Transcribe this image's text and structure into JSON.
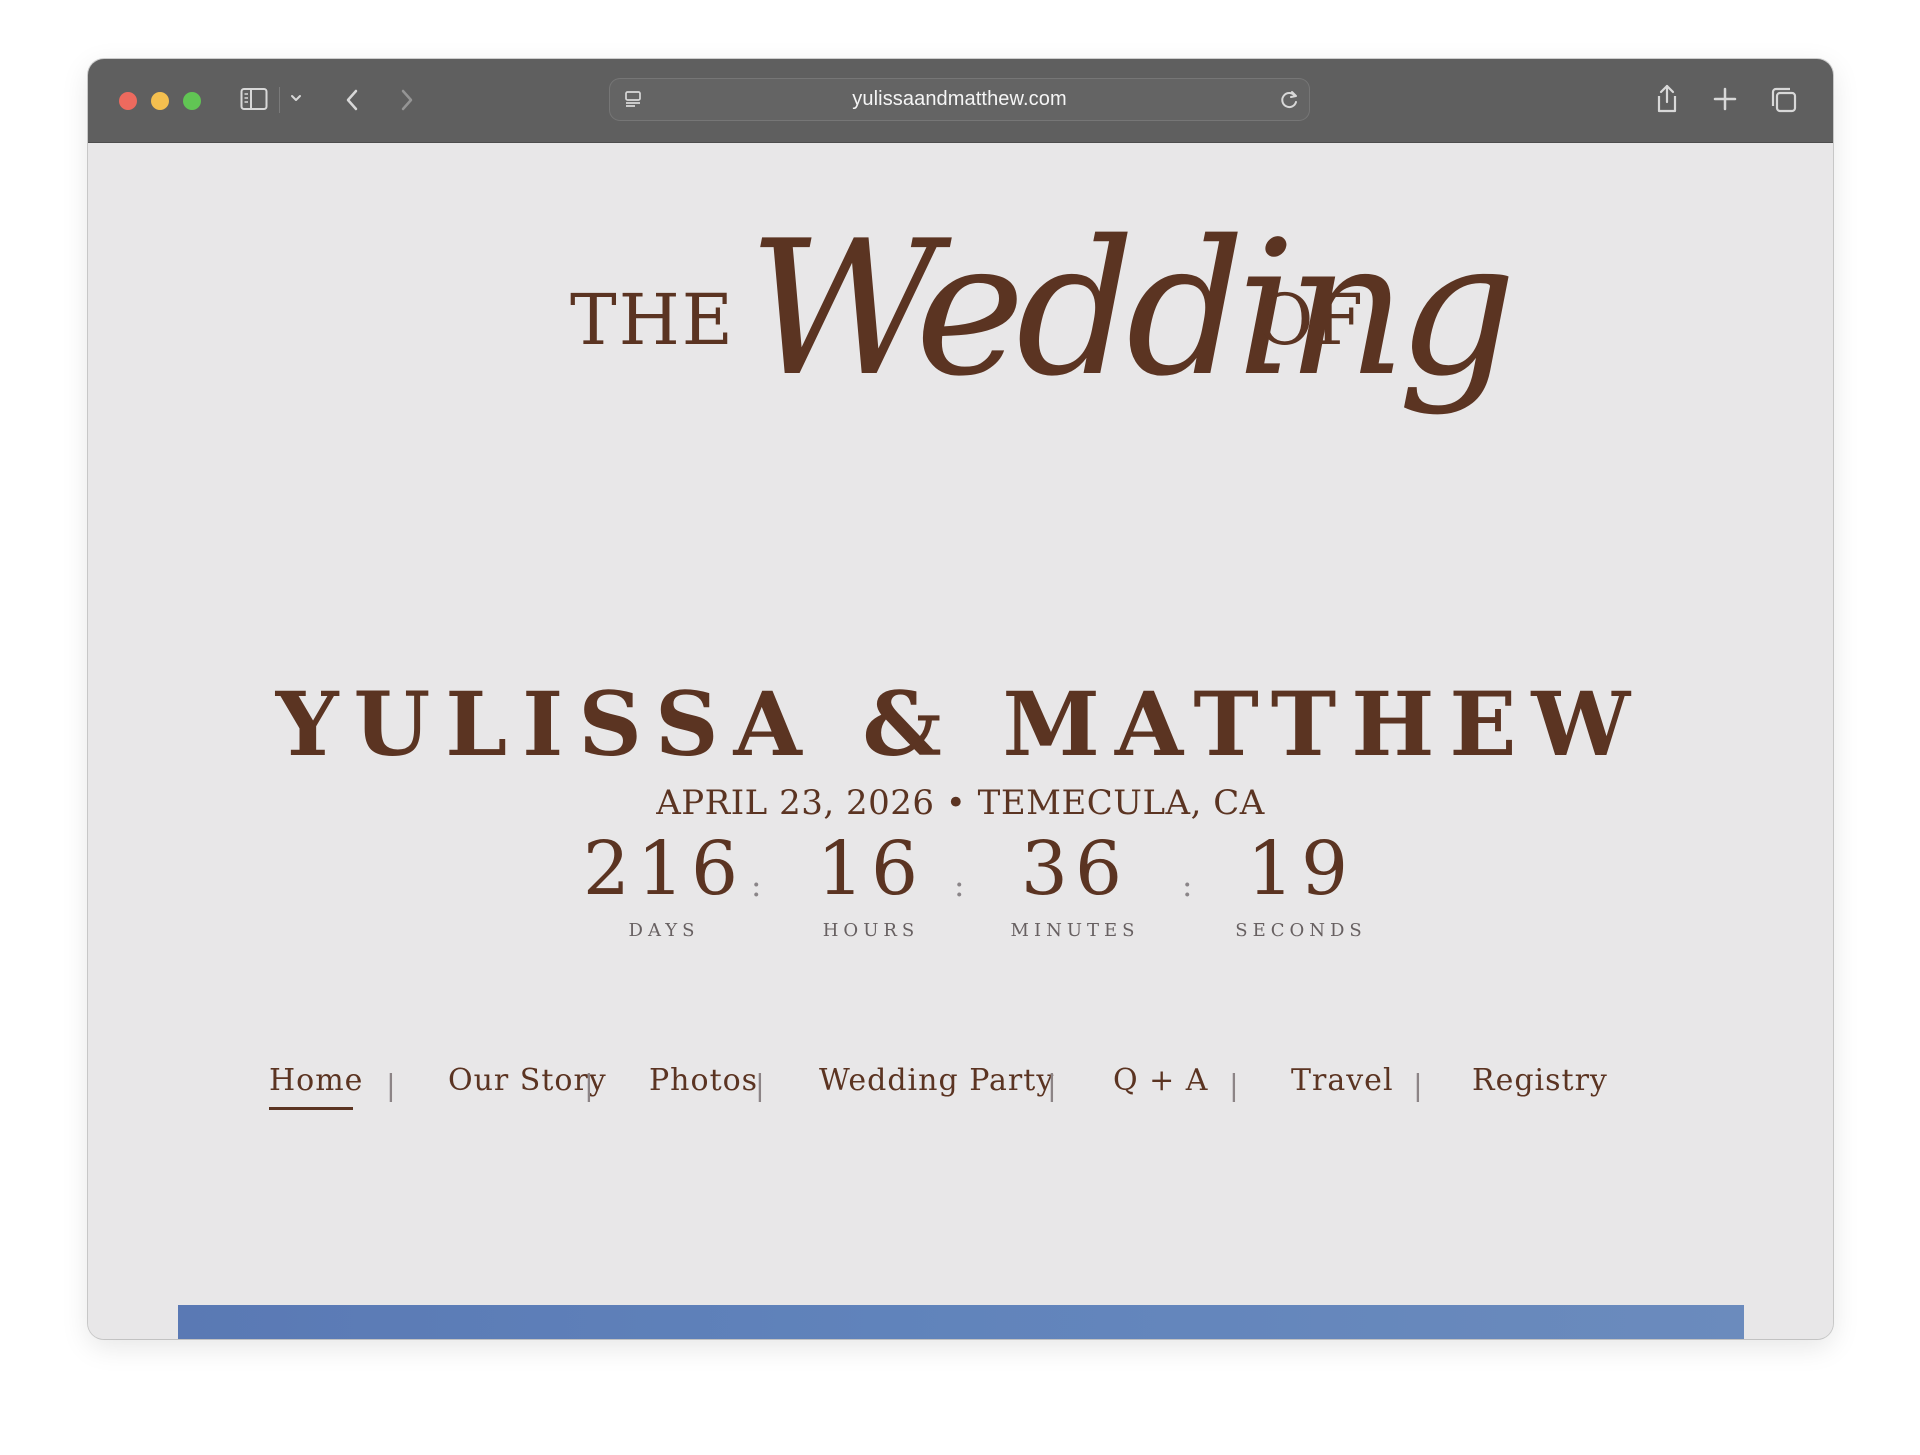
{
  "browser": {
    "url": "yulissaandmatthew.com"
  },
  "hero": {
    "the": "THE",
    "script": "Wedding",
    "of": "OF",
    "names": "YULISSA & MATTHEW",
    "event_details": "APRIL 23, 2026 • TEMECULA, CA"
  },
  "countdown": {
    "days": {
      "value": "216",
      "label": "DAYS"
    },
    "hours": {
      "value": "16",
      "label": "HOURS"
    },
    "minutes": {
      "value": "36",
      "label": "MINUTES"
    },
    "seconds": {
      "value": "19",
      "label": "SECONDS"
    },
    "separator": ":"
  },
  "navigation": {
    "items": [
      {
        "label": "Home"
      },
      {
        "label": "Our Story"
      },
      {
        "label": "Photos"
      },
      {
        "label": "Wedding Party"
      },
      {
        "label": "Q + A"
      },
      {
        "label": "Travel"
      },
      {
        "label": "Registry"
      }
    ],
    "divider": "|"
  },
  "colors": {
    "primary_text": "#5b3422",
    "page_background": "#e8e7e8",
    "toolbar": "#5f5f5f",
    "hero_image_strip": "#5f81b9"
  },
  "icons": {
    "sidebar": "sidebar-icon",
    "dropdown": "chevron-down-icon",
    "back": "chevron-left-icon",
    "forward": "chevron-right-icon",
    "page_menu": "page-menu-icon",
    "reload": "reload-icon",
    "share": "share-icon",
    "new_tab": "plus-icon",
    "tabs": "tabs-icon"
  }
}
